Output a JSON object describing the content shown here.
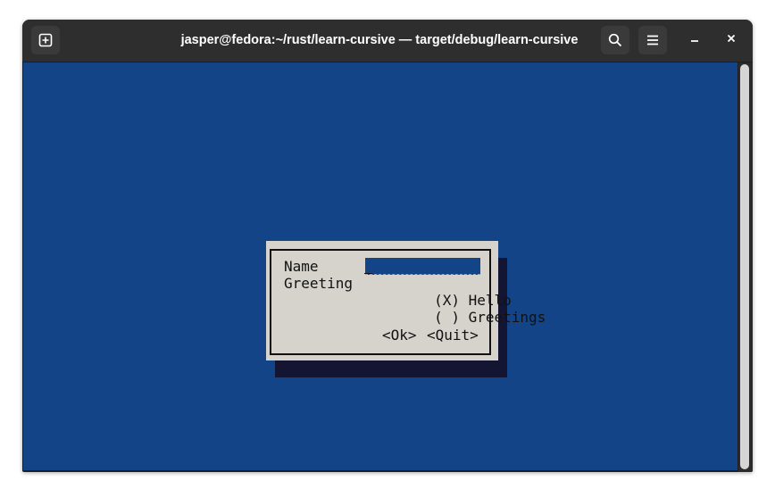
{
  "window": {
    "title": "jasper@fedora:~/rust/learn-cursive — target/debug/learn-cursive",
    "icons": {
      "new_tab": "new-tab-icon",
      "search": "search-icon",
      "menu": "hamburger-menu-icon",
      "minimize": "minimize-icon",
      "close": "close-icon"
    }
  },
  "terminal": {
    "background": "#134487"
  },
  "dialog": {
    "name_label": "Name",
    "name_value": "",
    "greeting_label": "Greeting",
    "options": [
      {
        "marker": "(X)",
        "label": "Hello",
        "selected": true
      },
      {
        "marker": "( )",
        "label": "Greetings",
        "selected": false
      }
    ],
    "buttons": {
      "ok": "<Ok>",
      "quit": "<Quit>"
    }
  }
}
